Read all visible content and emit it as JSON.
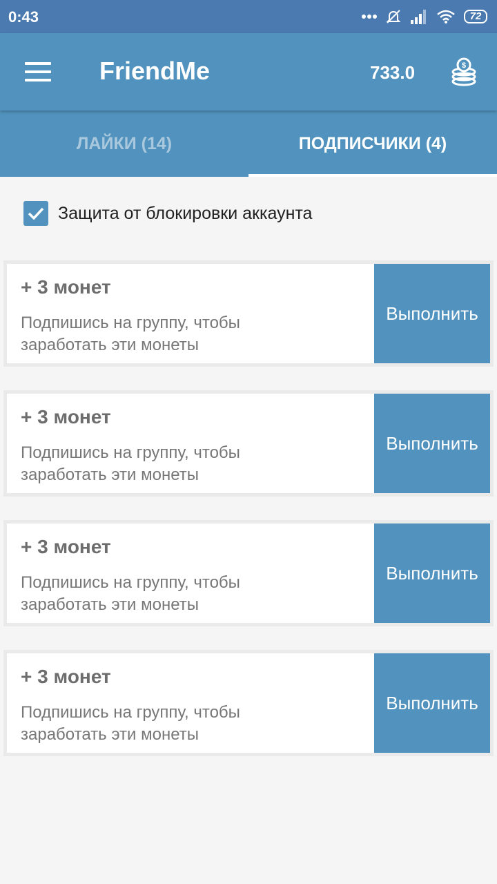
{
  "status_bar": {
    "time": "0:43",
    "battery": "72",
    "icons": [
      "more-dots-icon",
      "alarm-off-icon",
      "signal-icon",
      "wifi-icon",
      "battery-icon"
    ]
  },
  "app_bar": {
    "title": "FriendMe",
    "balance": "733.0",
    "menu_icon": "hamburger-menu-icon",
    "coins_icon": "coin-stack-icon",
    "color": "#5193be"
  },
  "tabs": [
    {
      "label": "ЛАЙКИ (14)",
      "active": false
    },
    {
      "label": "ПОДПИСЧИКИ (4)",
      "active": true
    }
  ],
  "protection": {
    "label": "Защита от блокировки аккаунта",
    "checked": true
  },
  "tasks": [
    {
      "reward": "+ 3 монет",
      "description": "Подпишись на группу, чтобы заработать эти монеты",
      "button": "Выполнить"
    },
    {
      "reward": "+ 3 монет",
      "description": "Подпишись на группу, чтобы заработать эти монеты",
      "button": "Выполнить"
    },
    {
      "reward": "+ 3 монет",
      "description": "Подпишись на группу, чтобы заработать эти монеты",
      "button": "Выполнить"
    },
    {
      "reward": "+ 3 монет",
      "description": "Подпишись на группу, чтобы заработать эти монеты",
      "button": "Выполнить"
    }
  ]
}
